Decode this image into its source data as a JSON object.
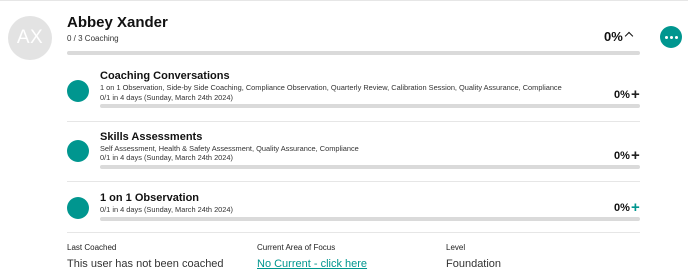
{
  "user": {
    "initials": "AX",
    "name": "Abbey Xander",
    "coaching_summary": "0 / 3 Coaching",
    "progress_text": "0%",
    "progress_fraction": 0
  },
  "sections": [
    {
      "title": "Coaching Conversations",
      "description": "1 on 1 Observation, Side-by Side Coaching, Compliance Observation, Quarterly Review, Calibration Session, Quality Assurance, Compliance",
      "due": "0/1 in 4 days (Sunday, March 24th 2024)",
      "progress_text": "0%",
      "progress_fraction": 0,
      "expand_symbol": "+"
    },
    {
      "title": "Skills Assessments",
      "description": "Self Assessment, Health & Safety Assessment, Quality Assurance, Compliance",
      "due": "0/1 in 4 days (Sunday, March 24th 2024)",
      "progress_text": "0%",
      "progress_fraction": 0,
      "expand_symbol": "+"
    },
    {
      "title": "1 on 1 Observation",
      "due": "0/1 in 4 days (Sunday, March 24th 2024)",
      "progress_text": "0%",
      "progress_fraction": 0,
      "expand_symbol": "+"
    }
  ],
  "footer": {
    "last_coached_label": "Last Coached",
    "last_coached_value": "This user has not been coached",
    "focus_label": "Current Area of Focus",
    "focus_link": "No Current - click here",
    "level_label": "Level",
    "level_value": "Foundation"
  },
  "icons": {
    "more": "more-horizontal-icon",
    "collapse": "chevron-up-icon",
    "expand": "plus-icon"
  },
  "colors": {
    "accent": "#00968f",
    "track": "#dadada",
    "avatar_bg": "#e3e3e3"
  }
}
